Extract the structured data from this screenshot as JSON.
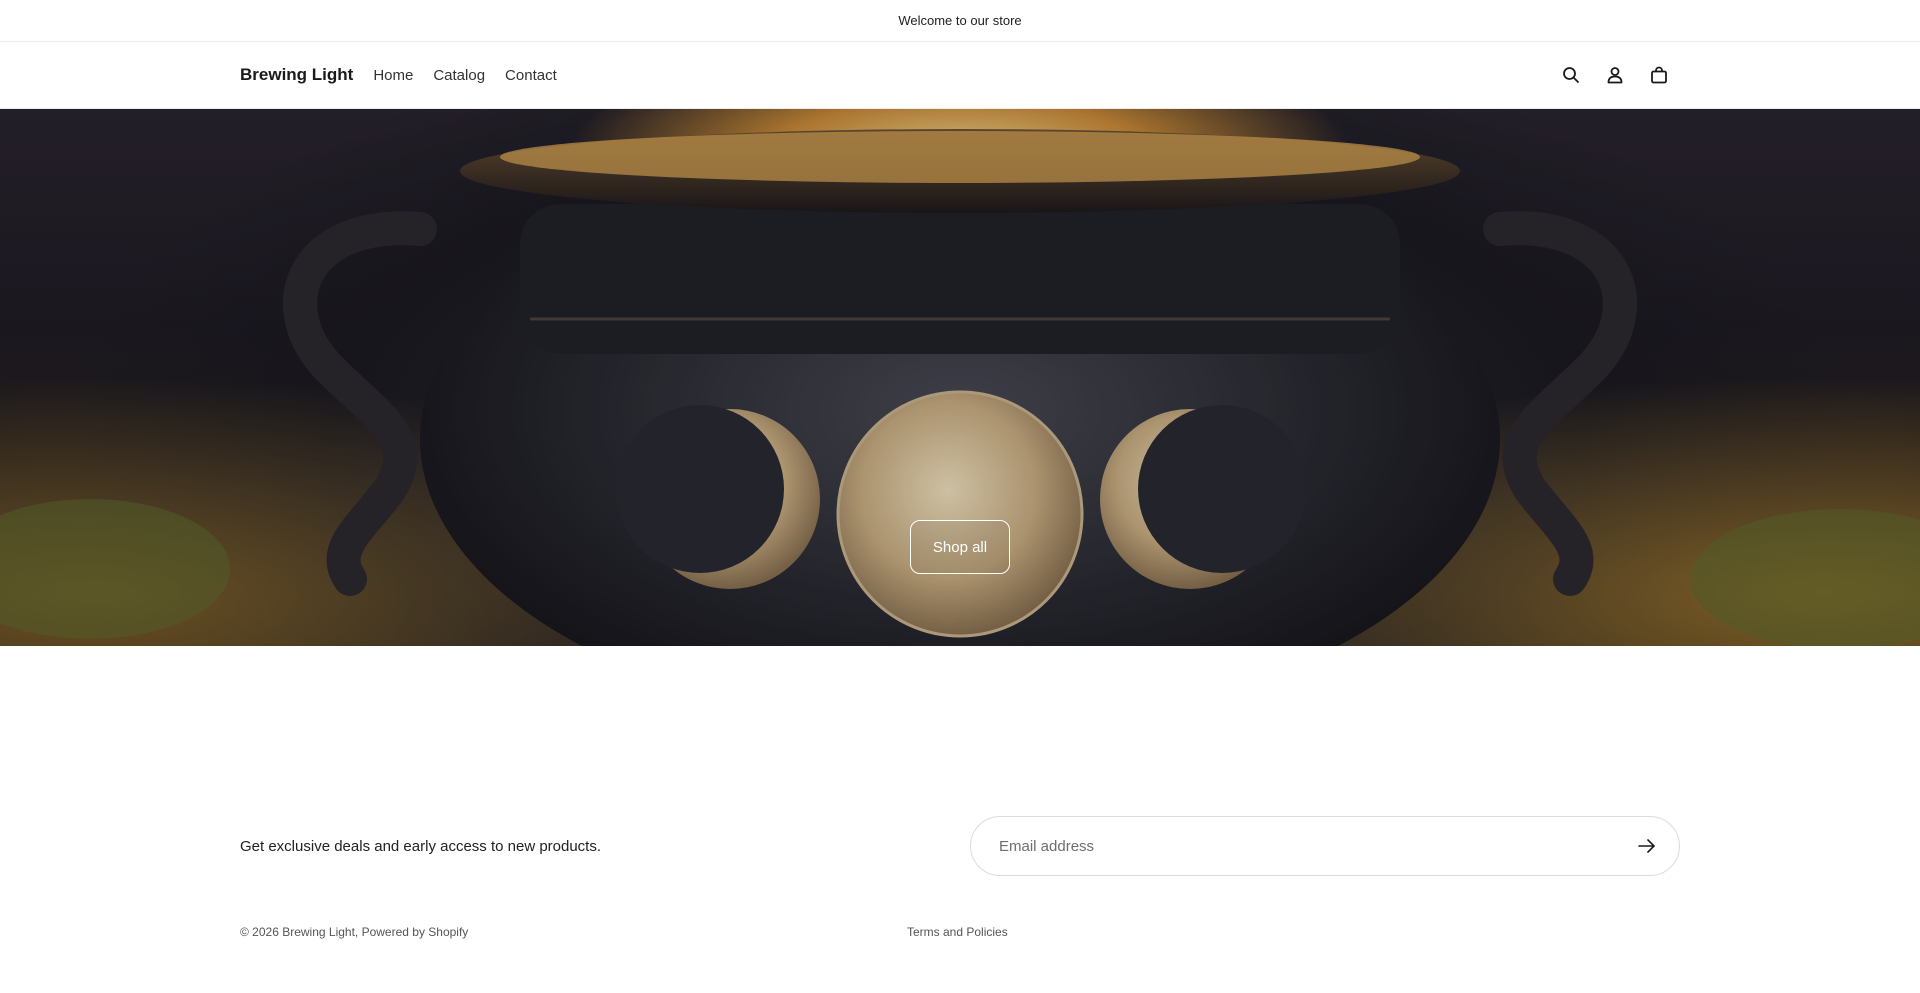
{
  "announcement": {
    "text": "Welcome to our store"
  },
  "header": {
    "logo": "Brewing Light",
    "nav": [
      {
        "label": "Home"
      },
      {
        "label": "Catalog"
      },
      {
        "label": "Contact"
      }
    ],
    "icons": [
      "search-icon",
      "account-icon",
      "cart-icon"
    ]
  },
  "hero": {
    "cta_label": "Shop all",
    "image_subject": "cauldron with triple moon"
  },
  "newsletter": {
    "text": "Get exclusive deals and early access to new products.",
    "email_placeholder": "Email address"
  },
  "footer": {
    "copyright": "© 2026 Brewing Light, Powered by Shopify",
    "terms": "Terms and Policies"
  },
  "colors": {
    "text": "#1a1a1a",
    "border": "#ececec",
    "hero_dark": "#1f1c25",
    "hero_glow": "#f2d48e"
  }
}
